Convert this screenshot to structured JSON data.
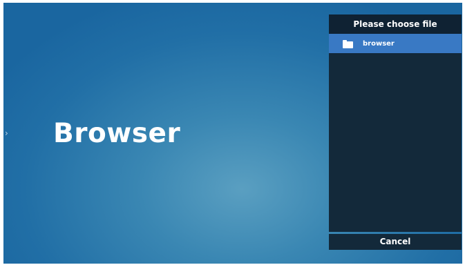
{
  "app": {
    "title": "Browser",
    "side_arrow": "›"
  },
  "file_dialog": {
    "title": "Please choose file",
    "items": [
      {
        "label": "browser",
        "icon": "folder-icon",
        "selected": true
      }
    ],
    "cancel_label": "Cancel"
  },
  "colors": {
    "background": "#216fa6",
    "panel": "#13293a",
    "selection": "#3979c4",
    "text": "#ffffff"
  }
}
